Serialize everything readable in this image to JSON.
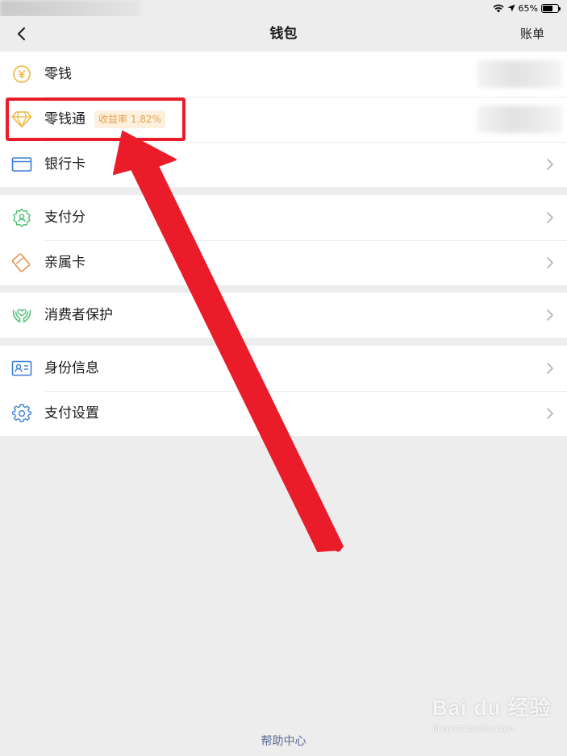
{
  "status_bar": {
    "battery": "65%",
    "battery_level": 0.65
  },
  "nav": {
    "title": "钱包",
    "right_label": "账单",
    "back_icon": "chevron-left-icon"
  },
  "groups": [
    {
      "items": [
        {
          "label": "零钱",
          "icon": "coin-yuan-icon"
        },
        {
          "label": "零钱通",
          "icon": "diamond-icon",
          "badge": "收益率 1.82%"
        },
        {
          "label": "银行卡",
          "icon": "bank-card-icon"
        }
      ]
    },
    {
      "items": [
        {
          "label": "支付分",
          "icon": "pay-score-icon"
        },
        {
          "label": "亲属卡",
          "icon": "family-card-icon"
        }
      ]
    },
    {
      "items": [
        {
          "label": "消费者保护",
          "icon": "protection-hands-icon"
        }
      ]
    },
    {
      "items": [
        {
          "label": "身份信息",
          "icon": "id-card-icon"
        },
        {
          "label": "支付设置",
          "icon": "gear-icon"
        }
      ]
    }
  ],
  "footer": {
    "help_label": "帮助中心"
  },
  "watermark": {
    "logo": "Bai du 经验",
    "url": "jingyan.baidu.com"
  },
  "colors": {
    "annotation_red": "#ea1c2a",
    "badge_text": "#e8a24b",
    "link_blue": "#576b95"
  }
}
